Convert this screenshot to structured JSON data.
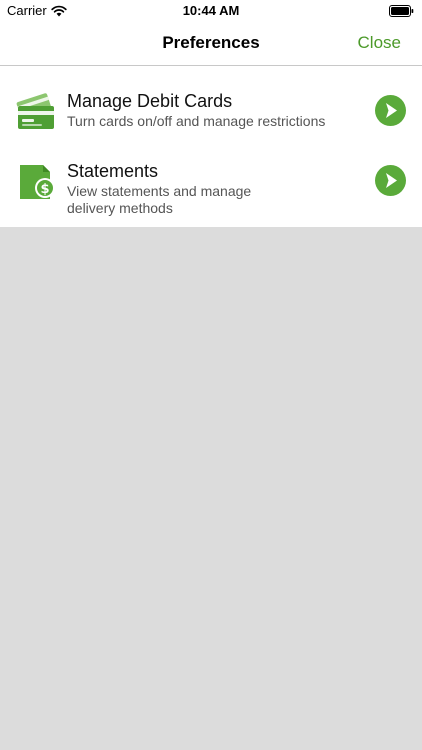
{
  "status_bar": {
    "carrier": "Carrier",
    "time": "10:44 AM",
    "wifi_icon": "wifi-icon",
    "battery_icon": "battery-icon"
  },
  "nav": {
    "title": "Preferences",
    "close_label": "Close"
  },
  "menu": {
    "items": [
      {
        "title": "Manage Debit Cards",
        "subtitle": "Turn cards on/off and manage restrictions",
        "icon": "debit-card-icon",
        "arrow_icon": "chevron-right-circle-icon"
      },
      {
        "title": "Statements",
        "subtitle_line1": "View statements and manage",
        "subtitle_line2": "delivery methods",
        "icon": "statement-document-icon",
        "arrow_icon": "chevron-right-circle-icon"
      }
    ]
  },
  "colors": {
    "accent": "#4c9a2a",
    "icon_green": "#5aaa3a",
    "background": "#dcdcdc",
    "surface": "#ffffff"
  }
}
